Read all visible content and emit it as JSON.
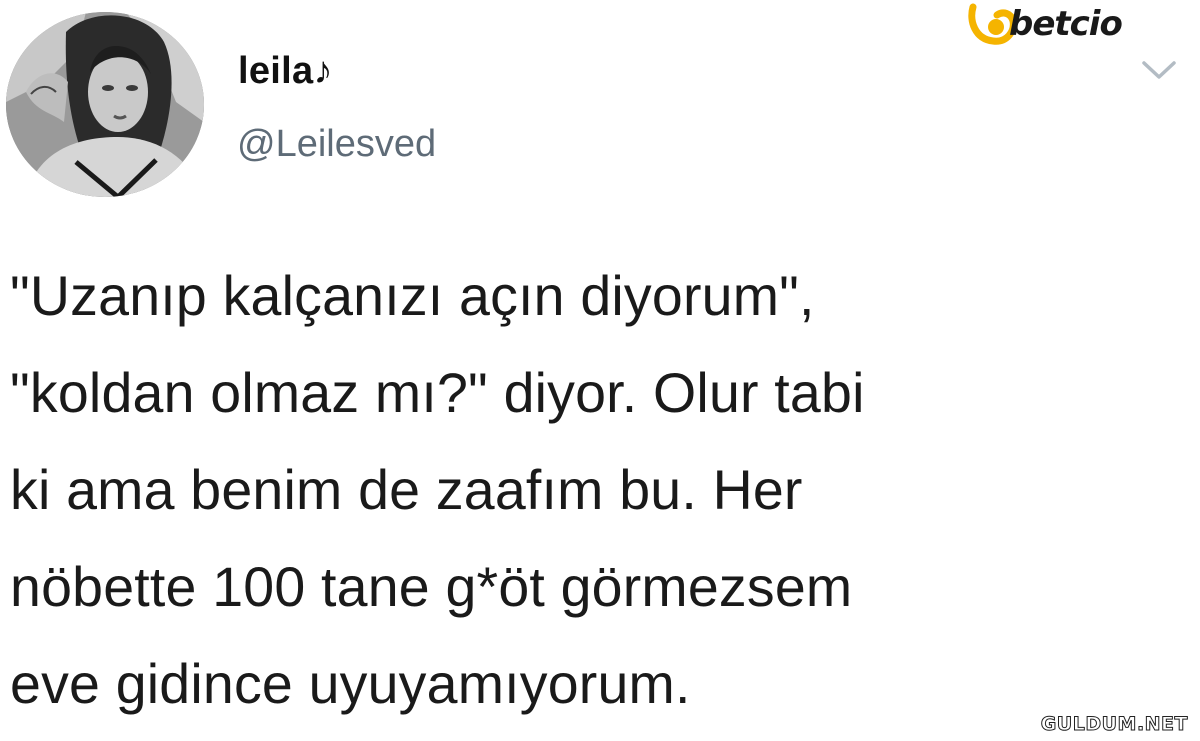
{
  "profile": {
    "display_name": "leila♪",
    "handle": "@Leilesved",
    "avatar_icon": "profile-photo"
  },
  "tweet": {
    "lines": [
      "\"Uzanıp kalçanızı açın diyorum\",",
      "\"koldan olmaz mı?\" diyor. Olur tabi",
      "ki ama benim de zaafım bu. Her",
      "nöbette 100 tane g*öt görmezsem",
      "eve gidince uyuyamıyorum."
    ]
  },
  "overlay": {
    "brand_logo_text": "betcio",
    "brand_color": "#f5b400",
    "watermark": "GULDUM.NET"
  },
  "actions": {
    "menu_icon": "chevron-down-icon"
  }
}
